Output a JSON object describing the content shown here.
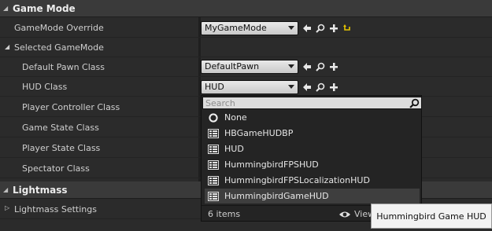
{
  "game_mode": {
    "section_title": "Game Mode",
    "override_label": "GameMode Override",
    "override_value": "MyGameMode",
    "selected_label": "Selected GameMode",
    "rows": [
      {
        "label": "Default Pawn Class",
        "value": "DefaultPawn"
      },
      {
        "label": "HUD Class",
        "value": "HUD"
      },
      {
        "label": "Player Controller Class"
      },
      {
        "label": "Game State Class"
      },
      {
        "label": "Player State Class"
      },
      {
        "label": "Spectator Class"
      }
    ]
  },
  "lightmass": {
    "section_title": "Lightmass",
    "settings_label": "Lightmass Settings"
  },
  "dropdown": {
    "search_placeholder": "Search",
    "items": [
      {
        "label": "None",
        "icon": "circle-icon"
      },
      {
        "label": "HBGameHUDBP",
        "icon": "class-icon"
      },
      {
        "label": "HUD",
        "icon": "class-icon"
      },
      {
        "label": "HummingbirdFPSHUD",
        "icon": "class-icon"
      },
      {
        "label": "HummingbirdFPSLocalizationHUD",
        "icon": "class-icon"
      },
      {
        "label": "HummingbirdGameHUD",
        "icon": "class-icon"
      }
    ],
    "count_label": "6 items",
    "view_label": "View"
  },
  "tooltip": {
    "text": "Hummingbird Game HUD"
  }
}
